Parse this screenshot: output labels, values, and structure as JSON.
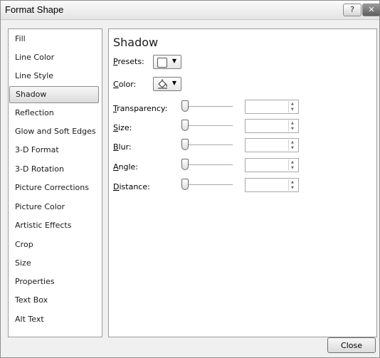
{
  "window": {
    "title": "Format Shape",
    "help_glyph": "?",
    "close_glyph": "✕"
  },
  "sidebar": {
    "items": [
      {
        "label": "Fill"
      },
      {
        "label": "Line Color"
      },
      {
        "label": "Line Style"
      },
      {
        "label": "Shadow",
        "selected": true
      },
      {
        "label": "Reflection"
      },
      {
        "label": "Glow and Soft Edges"
      },
      {
        "label": "3-D Format"
      },
      {
        "label": "3-D Rotation"
      },
      {
        "label": "Picture Corrections"
      },
      {
        "label": "Picture Color"
      },
      {
        "label": "Artistic Effects"
      },
      {
        "label": "Crop"
      },
      {
        "label": "Size"
      },
      {
        "label": "Properties"
      },
      {
        "label": "Text Box"
      },
      {
        "label": "Alt Text"
      }
    ]
  },
  "panel": {
    "title": "Shadow",
    "presets": {
      "label_accel": "P",
      "label_rest": "resets:"
    },
    "color": {
      "label_accel": "C",
      "label_rest": "olor:"
    },
    "rows": [
      {
        "accel": "T",
        "rest": "ransparency:",
        "value": ""
      },
      {
        "accel": "S",
        "rest": "ize:",
        "value": ""
      },
      {
        "accel": "B",
        "rest": "lur:",
        "value": ""
      },
      {
        "accel": "A",
        "rest": "ngle:",
        "value": ""
      },
      {
        "accel": "D",
        "rest": "istance:",
        "value": ""
      }
    ]
  },
  "footer": {
    "close_label": "Close"
  }
}
